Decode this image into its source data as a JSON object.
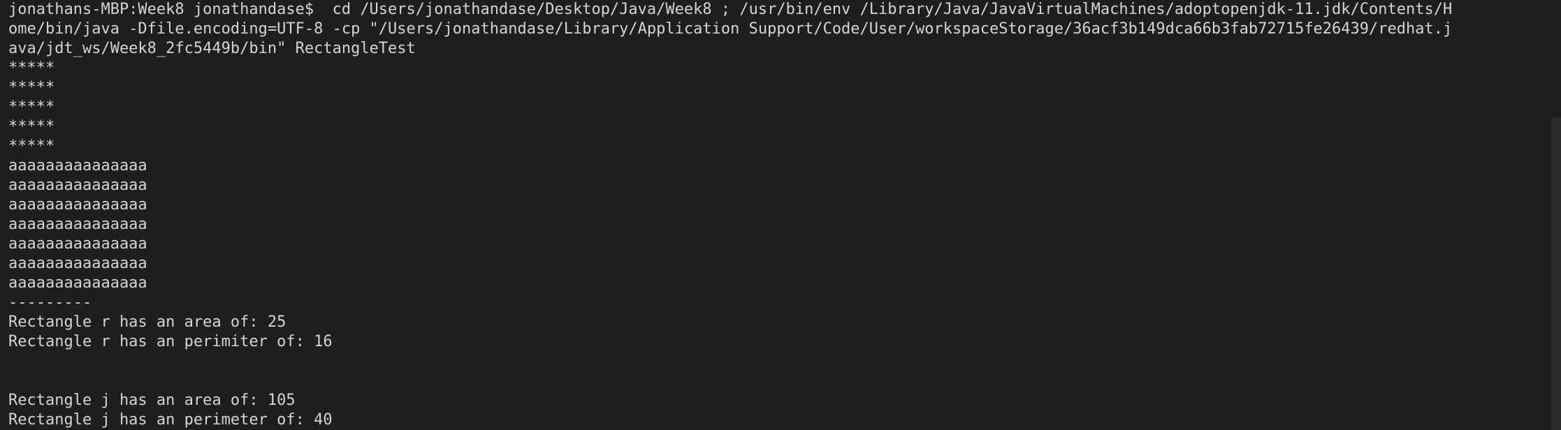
{
  "terminal": {
    "lines": [
      "jonathans-MBP:Week8 jonathandase$  cd /Users/jonathandase/Desktop/Java/Week8 ; /usr/bin/env /Library/Java/JavaVirtualMachines/adoptopenjdk-11.jdk/Contents/H",
      "ome/bin/java -Dfile.encoding=UTF-8 -cp \"/Users/jonathandase/Library/Application Support/Code/User/workspaceStorage/36acf3b149dca66b3fab72715fe26439/redhat.j",
      "ava/jdt_ws/Week8_2fc5449b/bin\" RectangleTest",
      "*****",
      "*****",
      "*****",
      "*****",
      "*****",
      "aaaaaaaaaaaaaaa",
      "aaaaaaaaaaaaaaa",
      "aaaaaaaaaaaaaaa",
      "aaaaaaaaaaaaaaa",
      "aaaaaaaaaaaaaaa",
      "aaaaaaaaaaaaaaa",
      "aaaaaaaaaaaaaaa",
      "---------",
      "Rectangle r has an area of: 25",
      "Rectangle r has an perimiter of: 16",
      "",
      "",
      "Rectangle j has an area of: 105",
      "Rectangle j has an perimeter of: 40"
    ]
  }
}
